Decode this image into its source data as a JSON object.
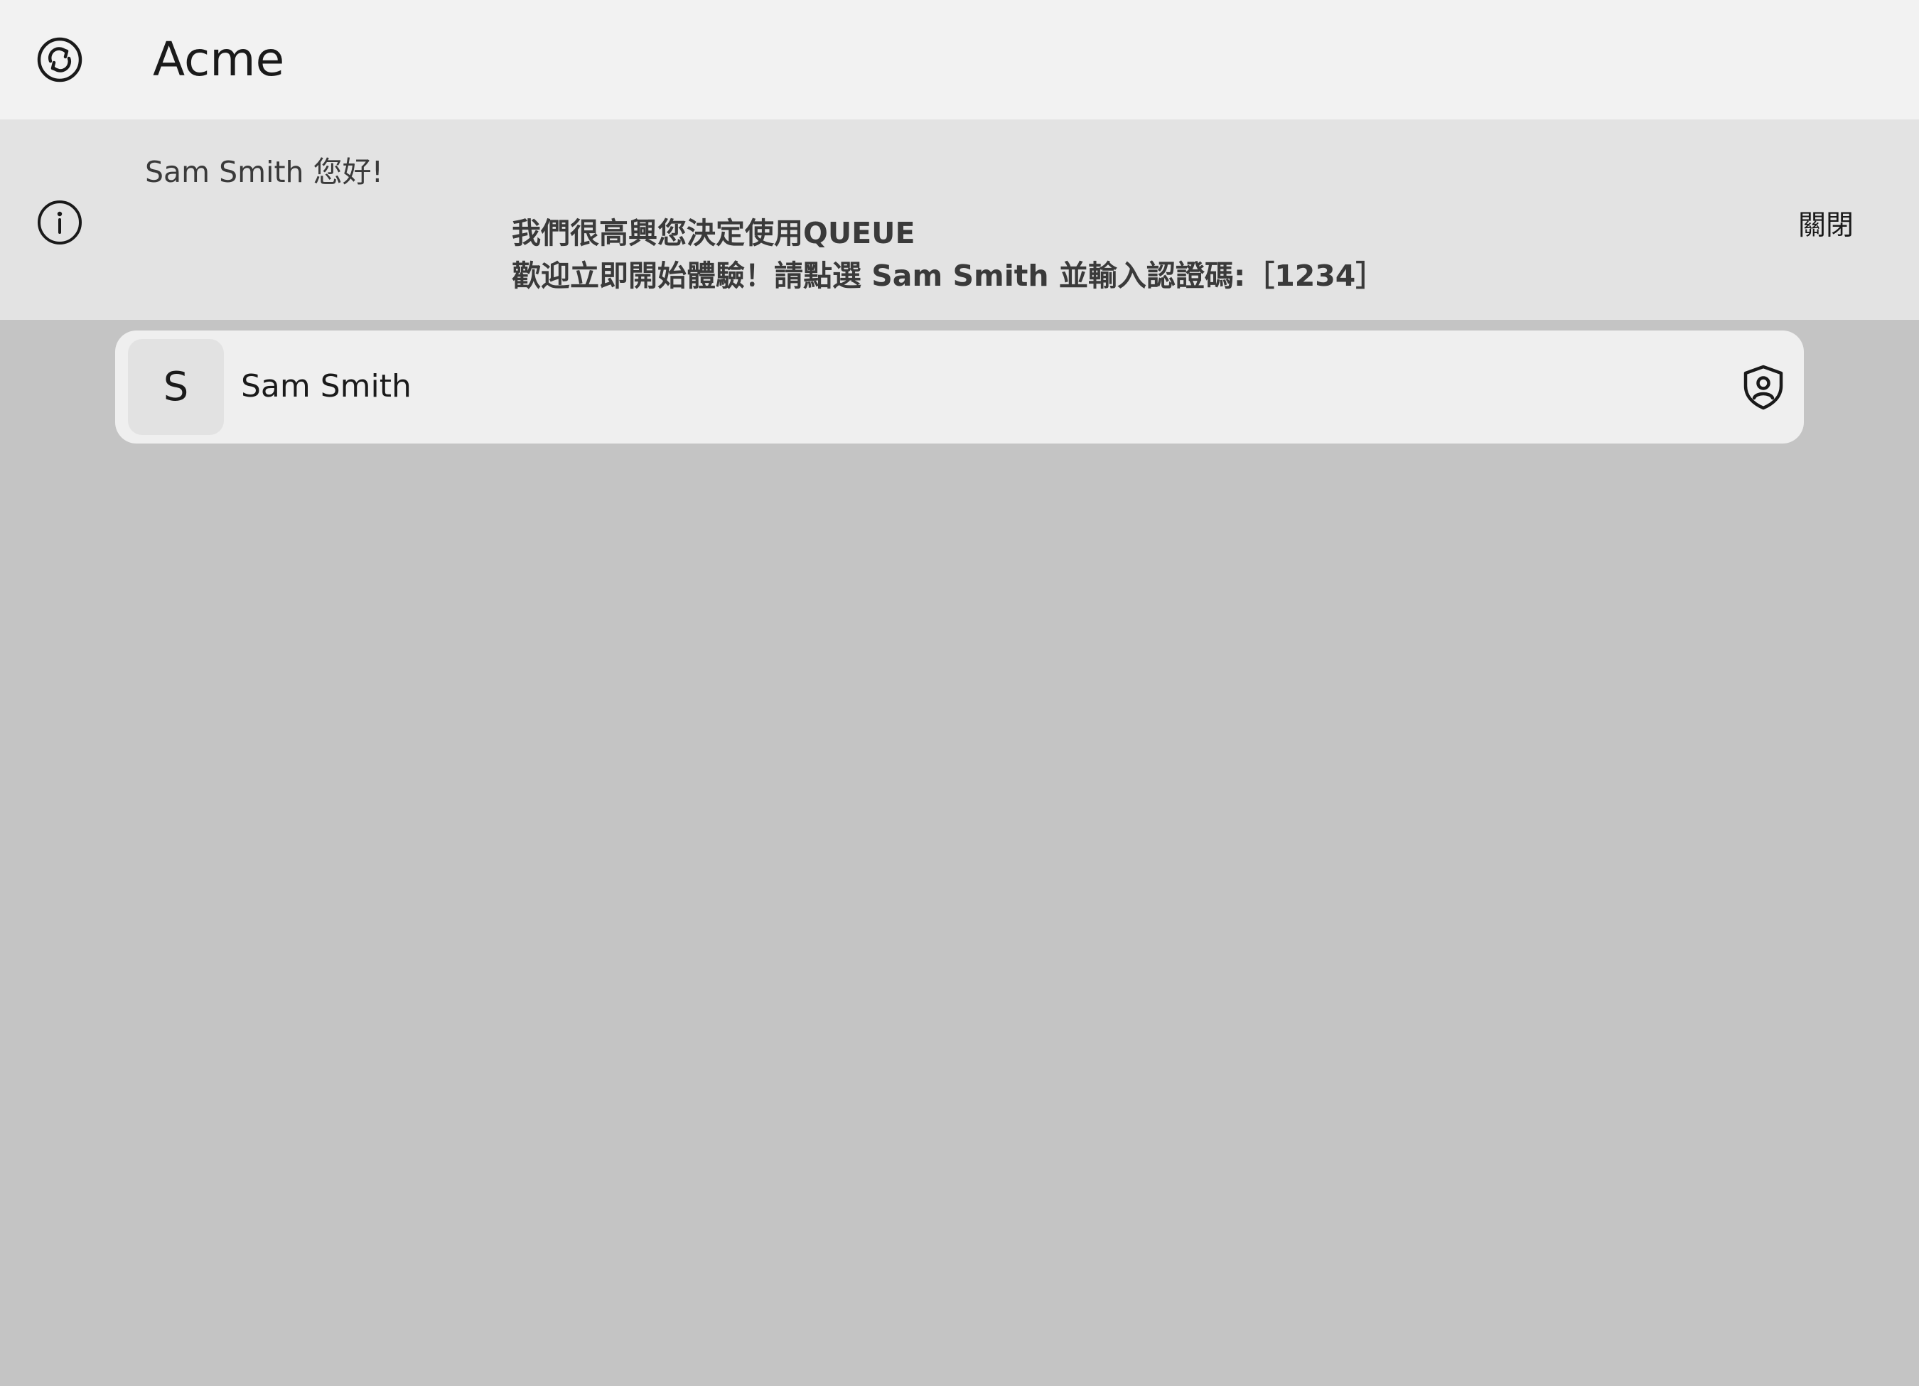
{
  "header": {
    "app_icon": "sync-icon",
    "title": "Acme"
  },
  "banner": {
    "icon": "info-icon",
    "greeting": "Sam Smith 您好!",
    "message_line1": "我們很高興您決定使用QUEUE",
    "message_line2": "歡迎立即開始體驗！請點選 Sam Smith 並輸入認證碼:［1234］",
    "close_label": "關閉"
  },
  "accounts": [
    {
      "initial": "S",
      "name": "Sam Smith",
      "icon": "shield-user-icon"
    }
  ]
}
